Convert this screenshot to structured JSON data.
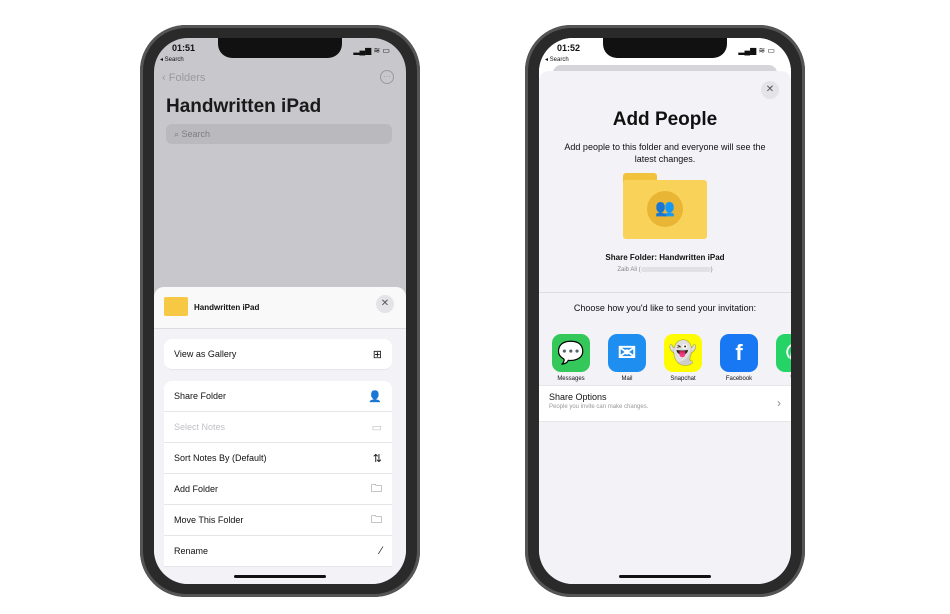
{
  "left": {
    "time": "01:51",
    "back_app": "◂ Search",
    "nav_back": "Folders",
    "title": "Handwritten iPad",
    "search_placeholder": "Search",
    "sheet": {
      "folder_name": "Handwritten iPad",
      "items": [
        {
          "label": "View as Gallery",
          "icon": "grid-icon",
          "glyph": "⊞"
        },
        {
          "label": "Share Folder",
          "icon": "share-person-icon",
          "glyph": "👤"
        },
        {
          "label": "Select Notes",
          "icon": "select-icon",
          "glyph": "▭",
          "disabled": true
        },
        {
          "label": "Sort Notes By (Default)",
          "icon": "sort-icon",
          "glyph": "⇅"
        },
        {
          "label": "Add Folder",
          "icon": "folder-add-icon",
          "glyph": "🗀"
        },
        {
          "label": "Move This Folder",
          "icon": "folder-icon",
          "glyph": "🗀"
        },
        {
          "label": "Rename",
          "icon": "pencil-icon",
          "glyph": "⁄"
        }
      ]
    }
  },
  "right": {
    "time": "01:52",
    "back_app": "◂ Search",
    "title": "Add People",
    "description": "Add people to this folder and everyone will see the latest changes.",
    "share_title": "Share Folder: Handwritten iPad",
    "owner": "Zaib Ali (",
    "choose": "Choose how you'd like to send your invitation:",
    "apps": [
      {
        "name": "Messages",
        "color": "#34c759"
      },
      {
        "name": "Mail",
        "color": "#1f8ef1"
      },
      {
        "name": "Snapchat",
        "color": "#fffc00"
      },
      {
        "name": "Facebook",
        "color": "#1877f2"
      },
      {
        "name": "Wh",
        "color": "#25d366"
      }
    ],
    "share_options": {
      "label": "Share Options",
      "sub": "People you invite can make changes."
    }
  }
}
